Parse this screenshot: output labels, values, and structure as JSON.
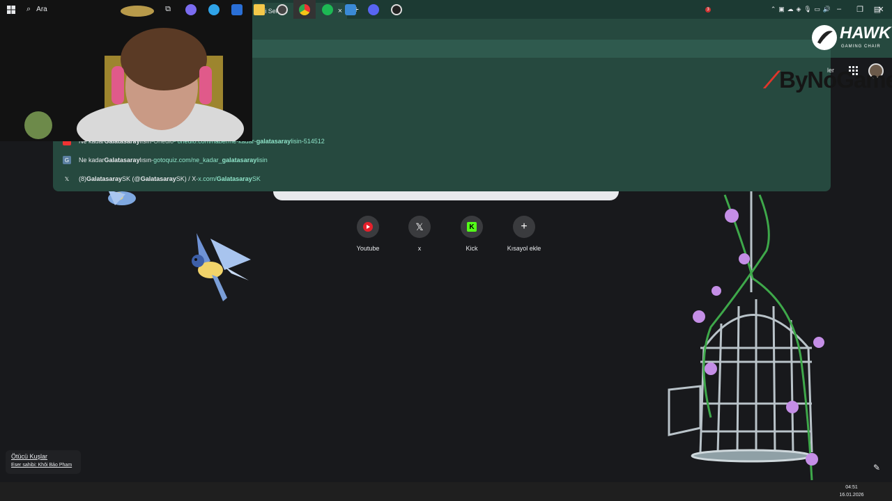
{
  "browser": {
    "tab_title": "Yeni Sekme",
    "tab_close": "×",
    "new_tab": "+",
    "window_controls": [
      "–",
      "❐",
      "✕"
    ]
  },
  "suggestions": [
    {
      "icon": "onedio-icon",
      "pre": "Ne kadar ",
      "bold": "Galatasaray",
      "post": "lısın",
      "sep": " - ",
      "site": "Onedio",
      "url_pre": " - onedio.com/haber/ne-kadar-",
      "url_bold": "galatasaray",
      "url_post": "lisin-514512"
    },
    {
      "icon": "gotoquiz-icon",
      "pre": "Ne kadar ",
      "bold": "Galatasaray",
      "post": "lısın",
      "sep": " - ",
      "site": "",
      "url_pre": "gotoquiz.com/ne_kadar_",
      "url_bold": "galatasaray",
      "url_post": "lisin"
    },
    {
      "icon": "x-icon",
      "pre": "(8) ",
      "bold": "Galatasaray",
      "post": " SK (@",
      "bold2": "Galatasaray",
      "post2": "SK) / X",
      "sep": " - ",
      "site": "",
      "url_pre": "x.com/",
      "url_bold": "Galatasaray",
      "url_post": "SK"
    }
  ],
  "header_partial_text": "ler",
  "shortcuts": [
    {
      "label": "Youtube",
      "icon": "youtube-icon"
    },
    {
      "label": "x",
      "icon": "x-icon"
    },
    {
      "label": "Kick",
      "icon": "kick-icon"
    },
    {
      "label": "Kısayol ekle",
      "icon": "plus-icon"
    }
  ],
  "overlays": {
    "hawk_text": "HAWK",
    "hawk_sub": "GAMING CHAIR",
    "bynogame": "ByNoGame"
  },
  "attribution": {
    "title": "Ötücü Kuşlar",
    "author": "Eser sahibi: Khôi Bảo Pham"
  },
  "taskbar": {
    "search_label": "Ara",
    "time": "04:51",
    "date": "16.01.2026",
    "notification_badge": "3"
  },
  "colors": {
    "chrome_frame": "#1c3a33",
    "toolbar": "#26493f",
    "background": "#18191c",
    "url_accent": "#8ee3c8"
  }
}
